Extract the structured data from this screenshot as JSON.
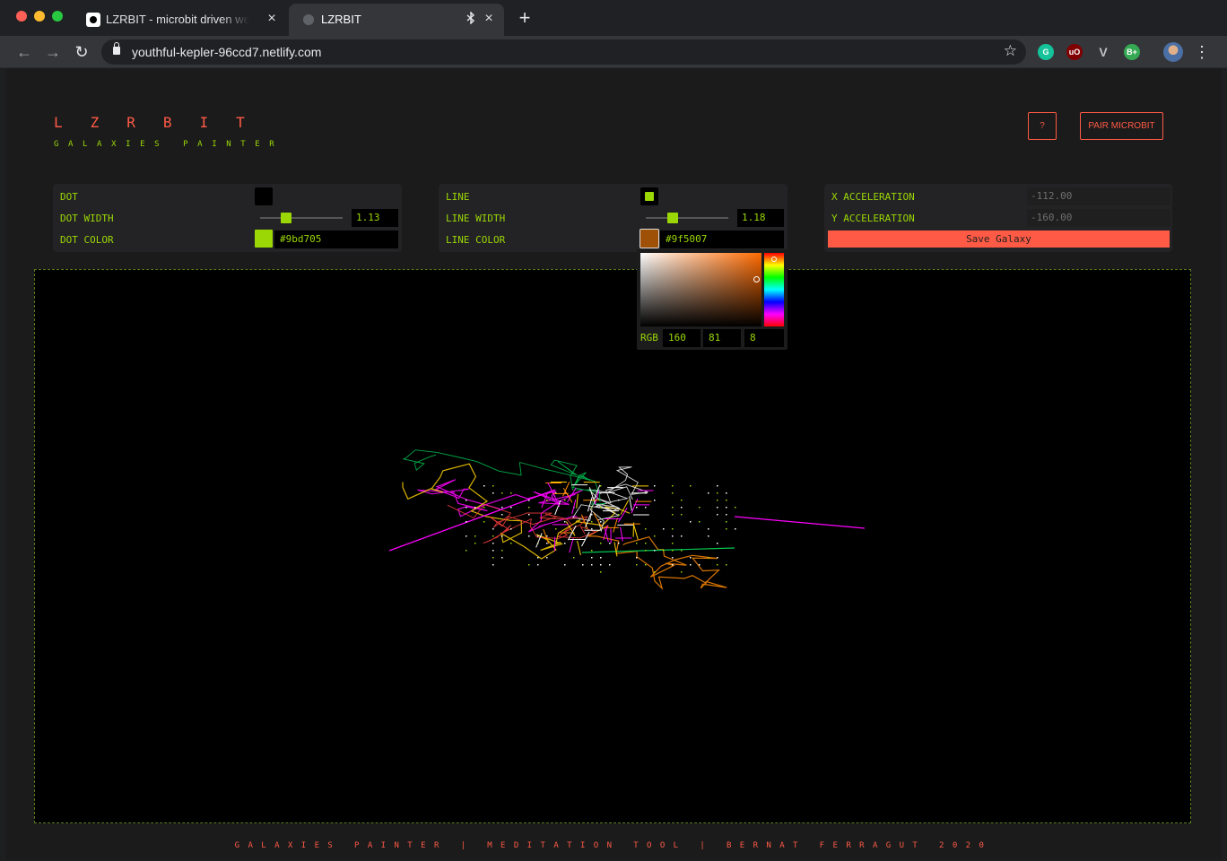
{
  "browser": {
    "tabs": [
      {
        "title": "LZRBIT - microbit driven web app",
        "close": "×"
      },
      {
        "title": "LZRBIT",
        "close": "×"
      }
    ],
    "new_tab": "+",
    "url": "youthful-kepler-96ccd7.netlify.com",
    "extensions": [
      "G",
      "uO",
      "V",
      "B+"
    ]
  },
  "header": {
    "logo": "LZRBIT",
    "subtitle": "GALAXIES PAINTER",
    "help_label": "?",
    "pair_label": "PAIR MICROBIT"
  },
  "dot_panel": {
    "dot_label": "DOT",
    "dot_enabled": false,
    "width_label": "DOT WIDTH",
    "width_value": "1.13",
    "width_fraction": 0.31,
    "color_label": "DOT COLOR",
    "color_value": "#9bd705"
  },
  "line_panel": {
    "line_label": "LINE",
    "line_enabled": true,
    "width_label": "LINE WIDTH",
    "width_value": "1.18",
    "width_fraction": 0.33,
    "color_label": "LINE COLOR",
    "color_value": "#9f5007"
  },
  "color_picker": {
    "mode_label": "RGB",
    "r": "160",
    "g": "81",
    "b": "8"
  },
  "accel_panel": {
    "x_label": "X ACCELERATION",
    "x_value": "-112.00",
    "y_label": "Y ACCELERATION",
    "y_value": "-160.00",
    "save_label": "Save Galaxy"
  },
  "footer": "GALAXIES PAINTER | MEDITATION TOOL | BERNAT FERRAGUT 2020",
  "colors": {
    "accent_red": "#ff5a45",
    "accent_green": "#9bd705",
    "line_color": "#9f5007",
    "galaxy": [
      "#ff00ff",
      "#ffd400",
      "#ff8a00",
      "#ffffff",
      "#00c853",
      "#ff4040"
    ]
  }
}
